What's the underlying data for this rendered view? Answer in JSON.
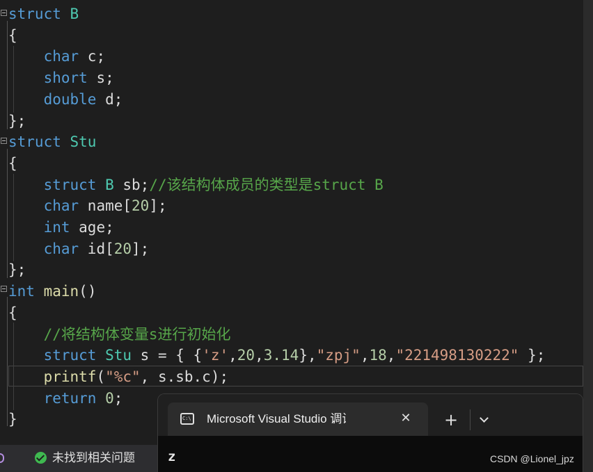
{
  "code": {
    "lines": [
      [
        {
          "t": "struct",
          "c": "kw"
        },
        {
          "t": " ",
          "c": "pl"
        },
        {
          "t": "B",
          "c": "ty"
        }
      ],
      [
        {
          "t": "{",
          "c": "pl"
        }
      ],
      [
        {
          "t": "    ",
          "c": "pl"
        },
        {
          "t": "char",
          "c": "kw"
        },
        {
          "t": " c;",
          "c": "pl"
        }
      ],
      [
        {
          "t": "    ",
          "c": "pl"
        },
        {
          "t": "short",
          "c": "kw"
        },
        {
          "t": " s;",
          "c": "pl"
        }
      ],
      [
        {
          "t": "    ",
          "c": "pl"
        },
        {
          "t": "double",
          "c": "kw"
        },
        {
          "t": " d;",
          "c": "pl"
        }
      ],
      [
        {
          "t": "};",
          "c": "pl"
        }
      ],
      [
        {
          "t": "struct",
          "c": "kw"
        },
        {
          "t": " ",
          "c": "pl"
        },
        {
          "t": "Stu",
          "c": "ty"
        }
      ],
      [
        {
          "t": "{",
          "c": "pl"
        }
      ],
      [
        {
          "t": "    ",
          "c": "pl"
        },
        {
          "t": "struct",
          "c": "kw"
        },
        {
          "t": " ",
          "c": "pl"
        },
        {
          "t": "B",
          "c": "ty"
        },
        {
          "t": " sb;",
          "c": "pl"
        },
        {
          "t": "//该结构体成员的类型是struct B",
          "c": "cm"
        }
      ],
      [
        {
          "t": "    ",
          "c": "pl"
        },
        {
          "t": "char",
          "c": "kw"
        },
        {
          "t": " name[",
          "c": "pl"
        },
        {
          "t": "20",
          "c": "num"
        },
        {
          "t": "];",
          "c": "pl"
        }
      ],
      [
        {
          "t": "    ",
          "c": "pl"
        },
        {
          "t": "int",
          "c": "kw"
        },
        {
          "t": " age;",
          "c": "pl"
        }
      ],
      [
        {
          "t": "    ",
          "c": "pl"
        },
        {
          "t": "char",
          "c": "kw"
        },
        {
          "t": " id[",
          "c": "pl"
        },
        {
          "t": "20",
          "c": "num"
        },
        {
          "t": "];",
          "c": "pl"
        }
      ],
      [
        {
          "t": "};",
          "c": "pl"
        }
      ],
      [
        {
          "t": "int",
          "c": "kw"
        },
        {
          "t": " ",
          "c": "pl"
        },
        {
          "t": "main",
          "c": "fn"
        },
        {
          "t": "()",
          "c": "pl"
        }
      ],
      [
        {
          "t": "{",
          "c": "pl"
        }
      ],
      [
        {
          "t": "    ",
          "c": "pl"
        },
        {
          "t": "//将结构体变量s进行初始化",
          "c": "cm"
        }
      ],
      [
        {
          "t": "    ",
          "c": "pl"
        },
        {
          "t": "struct",
          "c": "kw"
        },
        {
          "t": " ",
          "c": "pl"
        },
        {
          "t": "Stu",
          "c": "ty"
        },
        {
          "t": " s = { {",
          "c": "pl"
        },
        {
          "t": "'z'",
          "c": "str"
        },
        {
          "t": ",",
          "c": "pl"
        },
        {
          "t": "20",
          "c": "num"
        },
        {
          "t": ",",
          "c": "pl"
        },
        {
          "t": "3.14",
          "c": "num"
        },
        {
          "t": "},",
          "c": "pl"
        },
        {
          "t": "\"zpj\"",
          "c": "str"
        },
        {
          "t": ",",
          "c": "pl"
        },
        {
          "t": "18",
          "c": "num"
        },
        {
          "t": ",",
          "c": "pl"
        },
        {
          "t": "\"221498130222\"",
          "c": "str"
        },
        {
          "t": " };",
          "c": "pl"
        }
      ],
      [
        {
          "t": "    ",
          "c": "pl"
        },
        {
          "t": "printf",
          "c": "fn"
        },
        {
          "t": "(",
          "c": "pl"
        },
        {
          "t": "\"%c\"",
          "c": "str"
        },
        {
          "t": ", s.sb.c);",
          "c": "pl"
        }
      ],
      [
        {
          "t": "    ",
          "c": "pl"
        },
        {
          "t": "return",
          "c": "kw"
        },
        {
          "t": " ",
          "c": "pl"
        },
        {
          "t": "0",
          "c": "num"
        },
        {
          "t": ";",
          "c": "pl"
        }
      ],
      [
        {
          "t": "}",
          "c": "pl"
        }
      ]
    ],
    "current_line_index": 17,
    "colors": {
      "keyword": "#569cd6",
      "type": "#4ec9b0",
      "function": "#dcdcaa",
      "number": "#b5cea8",
      "string": "#d69d85",
      "comment": "#57a64a",
      "plain": "#dcdcdc"
    }
  },
  "status_bar": {
    "issues_icon": "check-circle-icon",
    "issues_label": "未找到相关问题"
  },
  "terminal": {
    "tab_icon": "console-icon",
    "tab_title": "Microsoft Visual Studio 调试控制台",
    "close_glyph": "✕",
    "add_glyph": "+",
    "output": "z"
  },
  "watermark": "CSDN @Lionel_jpz"
}
